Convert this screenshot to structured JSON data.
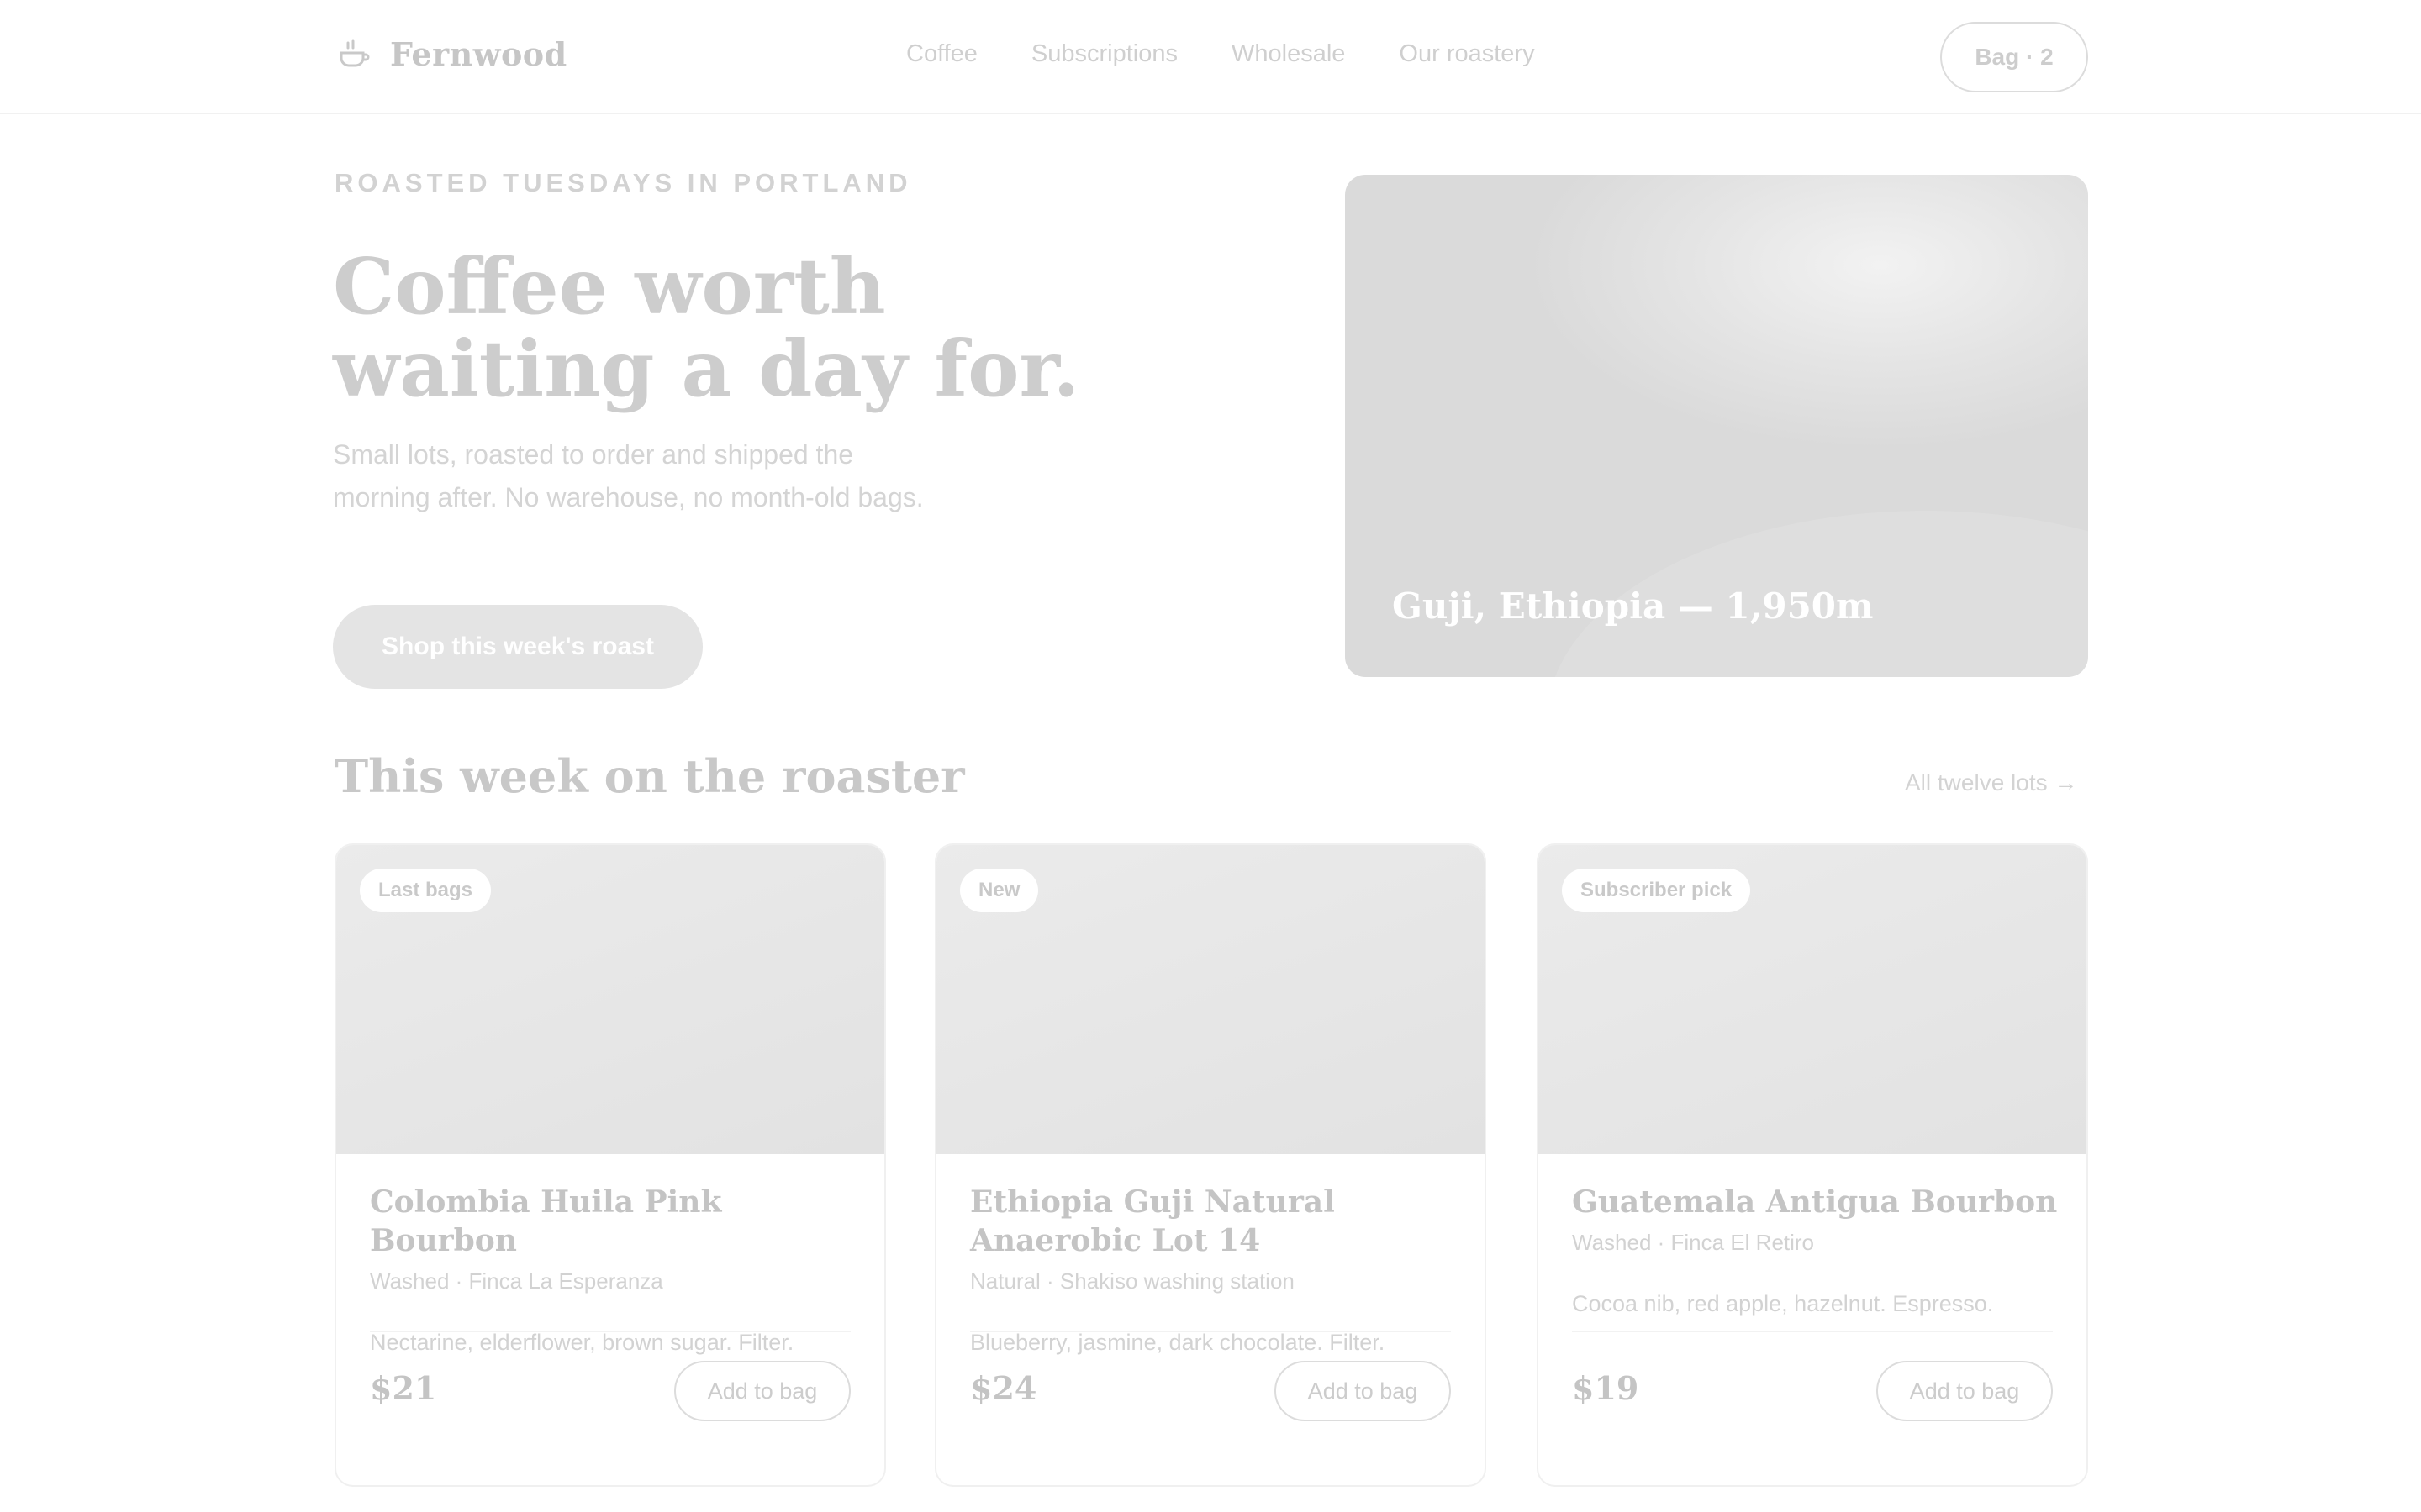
{
  "brand": {
    "name": "Fernwood",
    "icon": "cup-icon"
  },
  "nav": {
    "items": [
      "Coffee",
      "Subscriptions",
      "Wholesale",
      "Our roastery"
    ]
  },
  "bag": {
    "label": "Bag · 2"
  },
  "hero": {
    "eyebrow": "ROASTED TUESDAYS IN PORTLAND",
    "title_line1": "Coffee worth",
    "title_line2": "waiting a day for.",
    "subtitle": "Small lots, roasted to order and shipped the morning after. No warehouse, no month-old bags.",
    "cta": "Shop this week's roast",
    "image_caption": "Guji, Ethiopia — 1,950m"
  },
  "section": {
    "title": "This week on the roaster",
    "link": "All twelve lots →"
  },
  "cards": [
    {
      "badge": "Last bags",
      "name": "Colombia Huila Pink Bourbon",
      "origin": "Washed · Finca La Esperanza",
      "notes": "Nectarine, elderflower, brown sugar. Filter.",
      "price": "$21",
      "button": "Add to bag"
    },
    {
      "badge": "New",
      "name": "Ethiopia Guji Natural Anaerobic Lot 14",
      "origin": "Natural · Shakiso washing station",
      "notes": "Blueberry, jasmine, dark chocolate. Filter.",
      "price": "$24",
      "button": "Add to bag"
    },
    {
      "badge": "Subscriber pick",
      "name": "Guatemala Antigua Bourbon",
      "origin": "Washed · Finca El Retiro",
      "notes": "Cocoa nib, red apple, hazelnut. Espresso.",
      "price": "$19",
      "button": "Add to bag"
    }
  ]
}
